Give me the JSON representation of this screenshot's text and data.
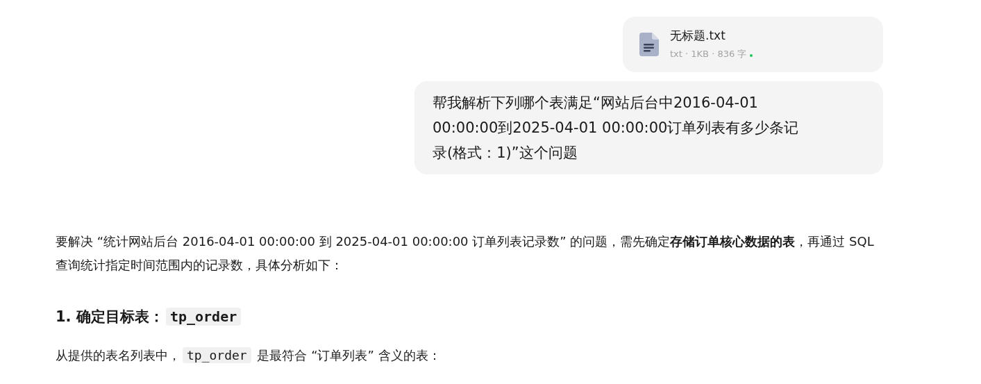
{
  "attachment": {
    "name": "无标题.txt",
    "meta": "txt · 1KB · 836 字",
    "uploaded": true
  },
  "user_message": "帮我解析下列哪个表满足“网站后台中2016-04-01 00:00:00到2025-04-01 00:00:00订单列表有多少条记录(格式：1)”这个问题",
  "answer": [
    {
      "kind": "paragraph",
      "parts": [
        {
          "kind": "text",
          "text": "要解决 “统计网站后台 2016-04-01 00:00:00 到 2025-04-01 00:00:00 订单列表记录数” 的问题，需先确定**存储订单核心数据的表**，再通过 SQL 查询统计指定时间范围内的记录数，具体分析如下："
        }
      ]
    },
    {
      "kind": "heading",
      "parts": [
        {
          "kind": "text",
          "text": "1. 确定目标表："
        },
        {
          "kind": "code",
          "text": "tp_order"
        }
      ]
    },
    {
      "kind": "paragraph",
      "parts": [
        {
          "kind": "text",
          "text": "从提供的表名列表中，"
        },
        {
          "kind": "code",
          "text": "tp_order"
        },
        {
          "kind": "text",
          "text": " 是最符合 “订单列表” 含义的表："
        }
      ]
    }
  ]
}
